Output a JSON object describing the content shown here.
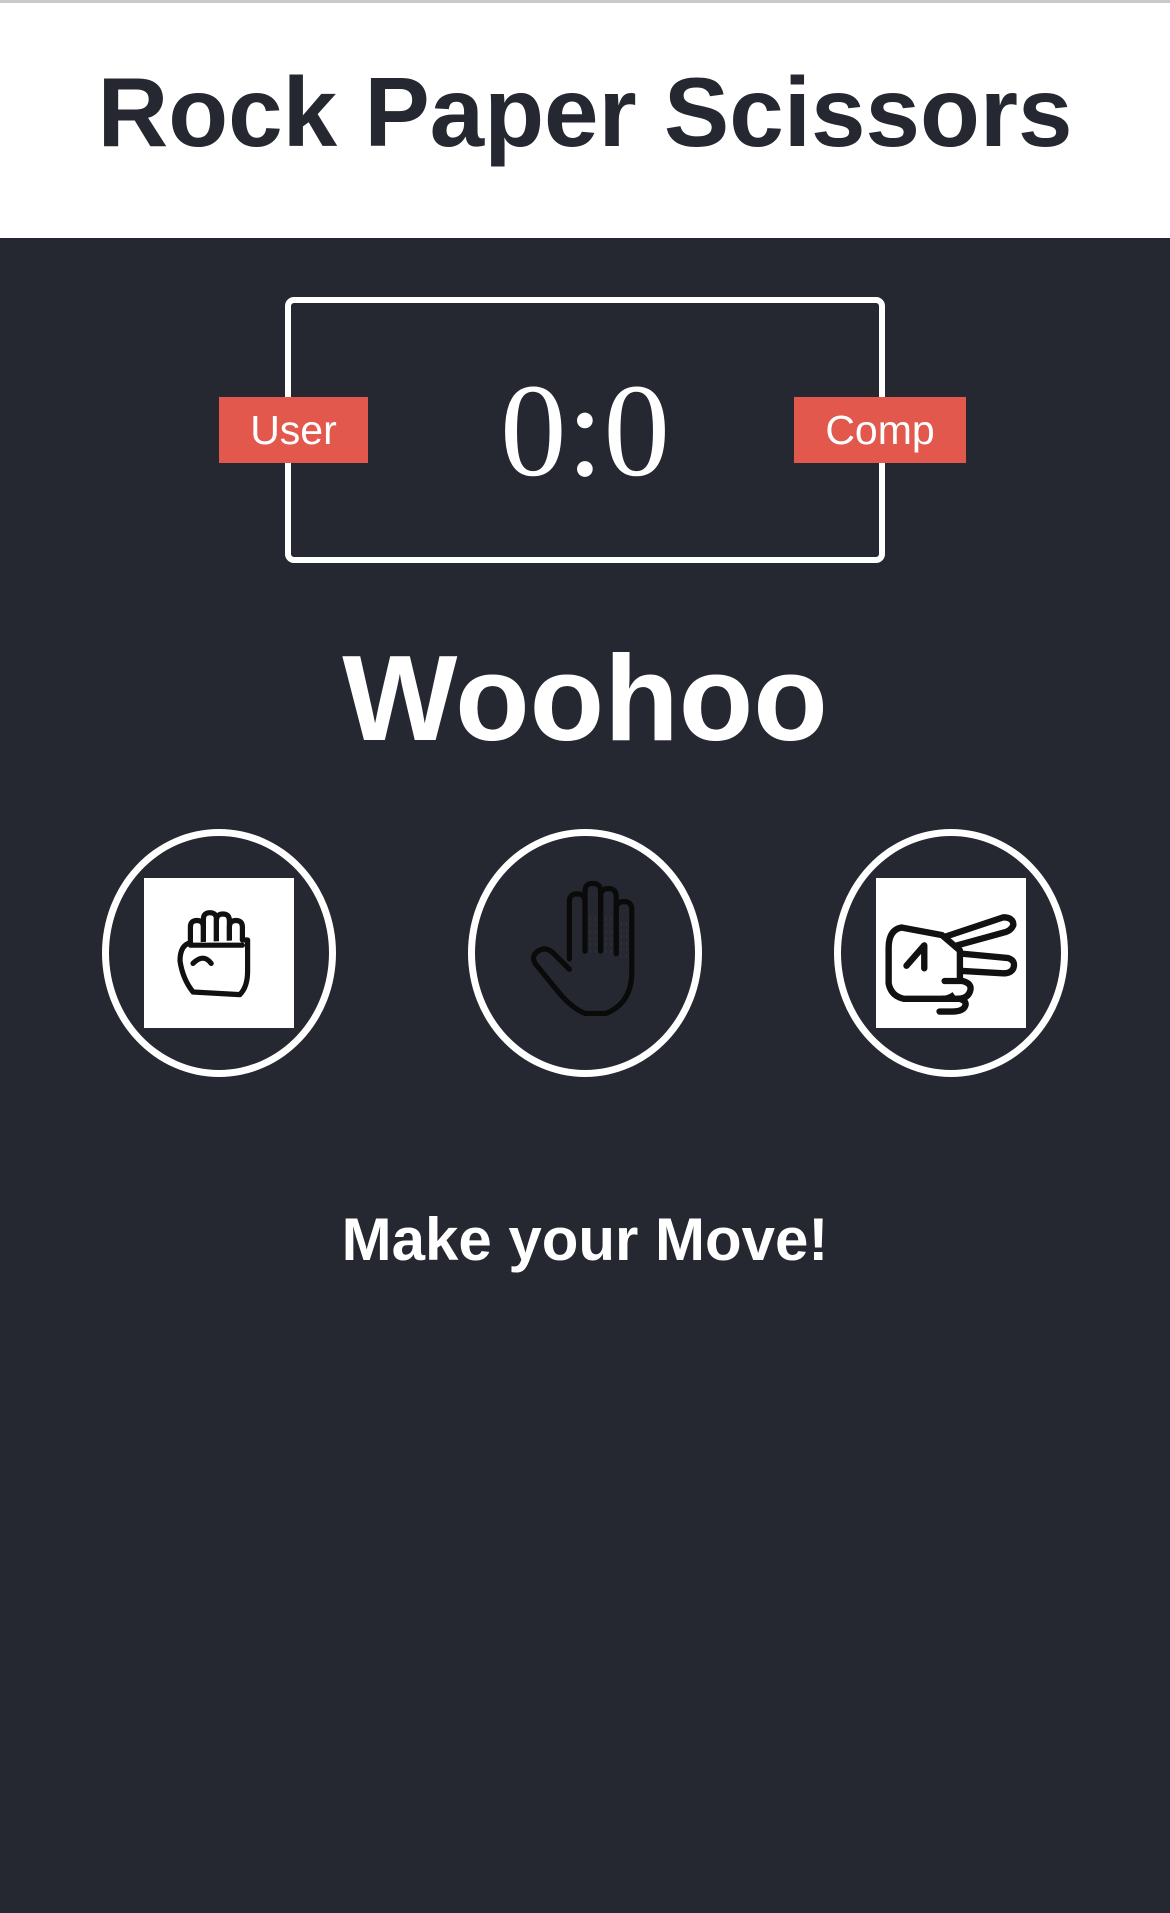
{
  "header": {
    "title": "Rock Paper Scissors"
  },
  "score_board": {
    "user_label": "User",
    "comp_label": "Comp",
    "score": "0:0"
  },
  "result": {
    "message": "Woohoo"
  },
  "choices": [
    {
      "name": "rock",
      "icon": "fist-hand-icon"
    },
    {
      "name": "paper",
      "icon": "open-hand-icon"
    },
    {
      "name": "scissors",
      "icon": "scissors-hand-icon"
    }
  ],
  "action_message": "Make your Move!",
  "colors": {
    "background": "#252830",
    "header_background": "#ffffff",
    "badge": "#e2584d",
    "text_light": "#ffffff"
  }
}
